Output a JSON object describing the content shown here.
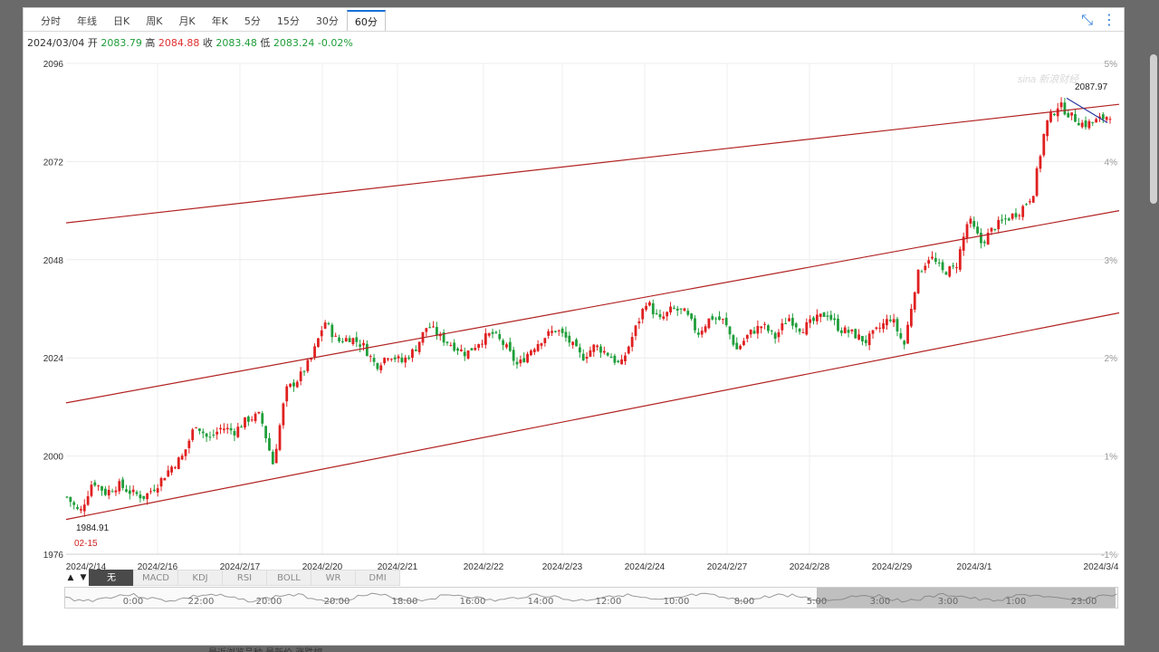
{
  "tabs": [
    "分时",
    "年线",
    "日K",
    "周K",
    "月K",
    "年K",
    "5分",
    "15分",
    "30分",
    "60分"
  ],
  "active_tab": "60分",
  "info": {
    "date": "2024/03/04",
    "open_label": "开",
    "open": "2083.79",
    "high_label": "高",
    "high": "2084.88",
    "close_label": "收",
    "close": "2083.48",
    "low_label": "低",
    "low": "2083.24",
    "change": "-0.02%"
  },
  "colors": {
    "up": "#e02020",
    "down": "#1f9e3a",
    "channel": "#b22222",
    "trend": "#2a3aa0",
    "accent": "#1a6fd6"
  },
  "icons": [
    "collapse-icon",
    "more-vert-icon"
  ],
  "indicators": {
    "arrows": [
      "▲",
      "▼"
    ],
    "items": [
      "无",
      "MACD",
      "KDJ",
      "RSI",
      "BOLL",
      "WR",
      "DMI"
    ],
    "active": "无"
  },
  "navigator_labels": [
    "0:00",
    "22:00",
    "20:00",
    "20:00",
    "18:00",
    "16:00",
    "14:00",
    "12:00",
    "10:00",
    "8:00",
    "5:00",
    "3:00",
    "3:00",
    "1:00",
    "23:00"
  ],
  "chart_data": {
    "type": "candlestick",
    "title": "",
    "ylim": [
      1976,
      2096
    ],
    "y_ticks": [
      1976,
      2000,
      2024,
      2048,
      2072,
      2096
    ],
    "y2_ticks": [
      "-1%",
      "1%",
      "2%",
      "3%",
      "4%",
      "5%"
    ],
    "x_tick_labels": [
      "2024/2/14",
      "2024/2/16",
      "2024/2/17",
      "2024/2/20",
      "2024/2/21",
      "2024/2/22",
      "2024/2/23",
      "2024/2/24",
      "2024/2/27",
      "2024/2/28",
      "2024/2/29",
      "2024/3/1",
      "2024/3/4"
    ],
    "annotations": {
      "min_value": "1984.91",
      "min_date": "02-15",
      "max_value": "2087.97"
    },
    "close_path": [
      1990,
      1986,
      1994,
      1991,
      1993,
      1991,
      1990,
      1993,
      1997,
      2000,
      2008,
      2004,
      2007,
      2006,
      2009,
      2010,
      1998,
      2016,
      2019,
      2024,
      2033,
      2028,
      2029,
      2027,
      2022,
      2025,
      2023,
      2026,
      2032,
      2029,
      2027,
      2025,
      2028,
      2030,
      2027,
      2022,
      2026,
      2029,
      2031,
      2028,
      2024,
      2027,
      2025,
      2022,
      2030,
      2038,
      2033,
      2036,
      2035,
      2030,
      2034,
      2033,
      2026,
      2030,
      2032,
      2029,
      2034,
      2031,
      2033,
      2035,
      2031,
      2030,
      2028,
      2031,
      2034,
      2027,
      2044,
      2049,
      2045,
      2046,
      2058,
      2052,
      2056,
      2058,
      2060,
      2064,
      2081,
      2086,
      2083,
      2081,
      2082,
      2083.5
    ],
    "channel_lines": [
      {
        "name": "upper",
        "start": 2057,
        "end": 2086
      },
      {
        "name": "middle",
        "start": 2013,
        "end": 2060
      },
      {
        "name": "lower",
        "start": 1984.5,
        "end": 2035
      }
    ],
    "trend_line": {
      "start": 2087.5,
      "end": 2081.5
    }
  },
  "watermark": "sina 新浪财经",
  "below_text": "最近浏览品种   最新价   涨跌幅"
}
